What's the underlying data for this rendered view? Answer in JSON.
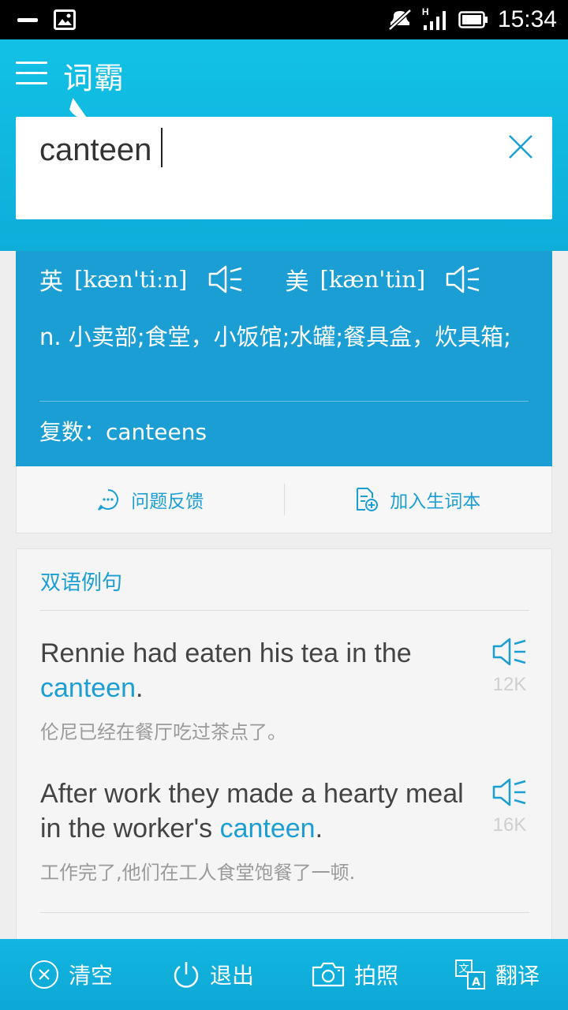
{
  "status": {
    "time": "15:34",
    "network": "H"
  },
  "header": {
    "app_title": "词霸"
  },
  "search": {
    "value": "canteen"
  },
  "entry": {
    "uk_label": "英",
    "uk_phonetic": "[kæn'tiːn]",
    "us_label": "美",
    "us_phonetic": "[kæn'tin]",
    "definition": "n. 小卖部;食堂，小饭馆;水罐;餐具盒，炊具箱;",
    "plural": "复数：canteens"
  },
  "actions": {
    "feedback": "问题反馈",
    "add_wordbook": "加入生词本"
  },
  "examples": {
    "title": "双语例句",
    "items": [
      {
        "en_before": "Rennie had eaten his tea in the ",
        "en_highlight": "canteen",
        "en_after": ".",
        "cn": "伦尼已经在餐厅吃过茶点了。",
        "count": "12K"
      },
      {
        "en_before": "After work they made a hearty meal in the worker's ",
        "en_highlight": "canteen",
        "en_after": ".",
        "cn": "工作完了,他们在工人食堂饱餐了一顿.",
        "count": "16K"
      }
    ]
  },
  "bottom_bar": {
    "clear": "清空",
    "exit": "退出",
    "photo": "拍照",
    "translate": "翻译"
  },
  "colors": {
    "header": "#12c1e6",
    "card": "#1b9ed3",
    "accent": "#1b9ed3",
    "bottom": "#0ea7d6"
  }
}
